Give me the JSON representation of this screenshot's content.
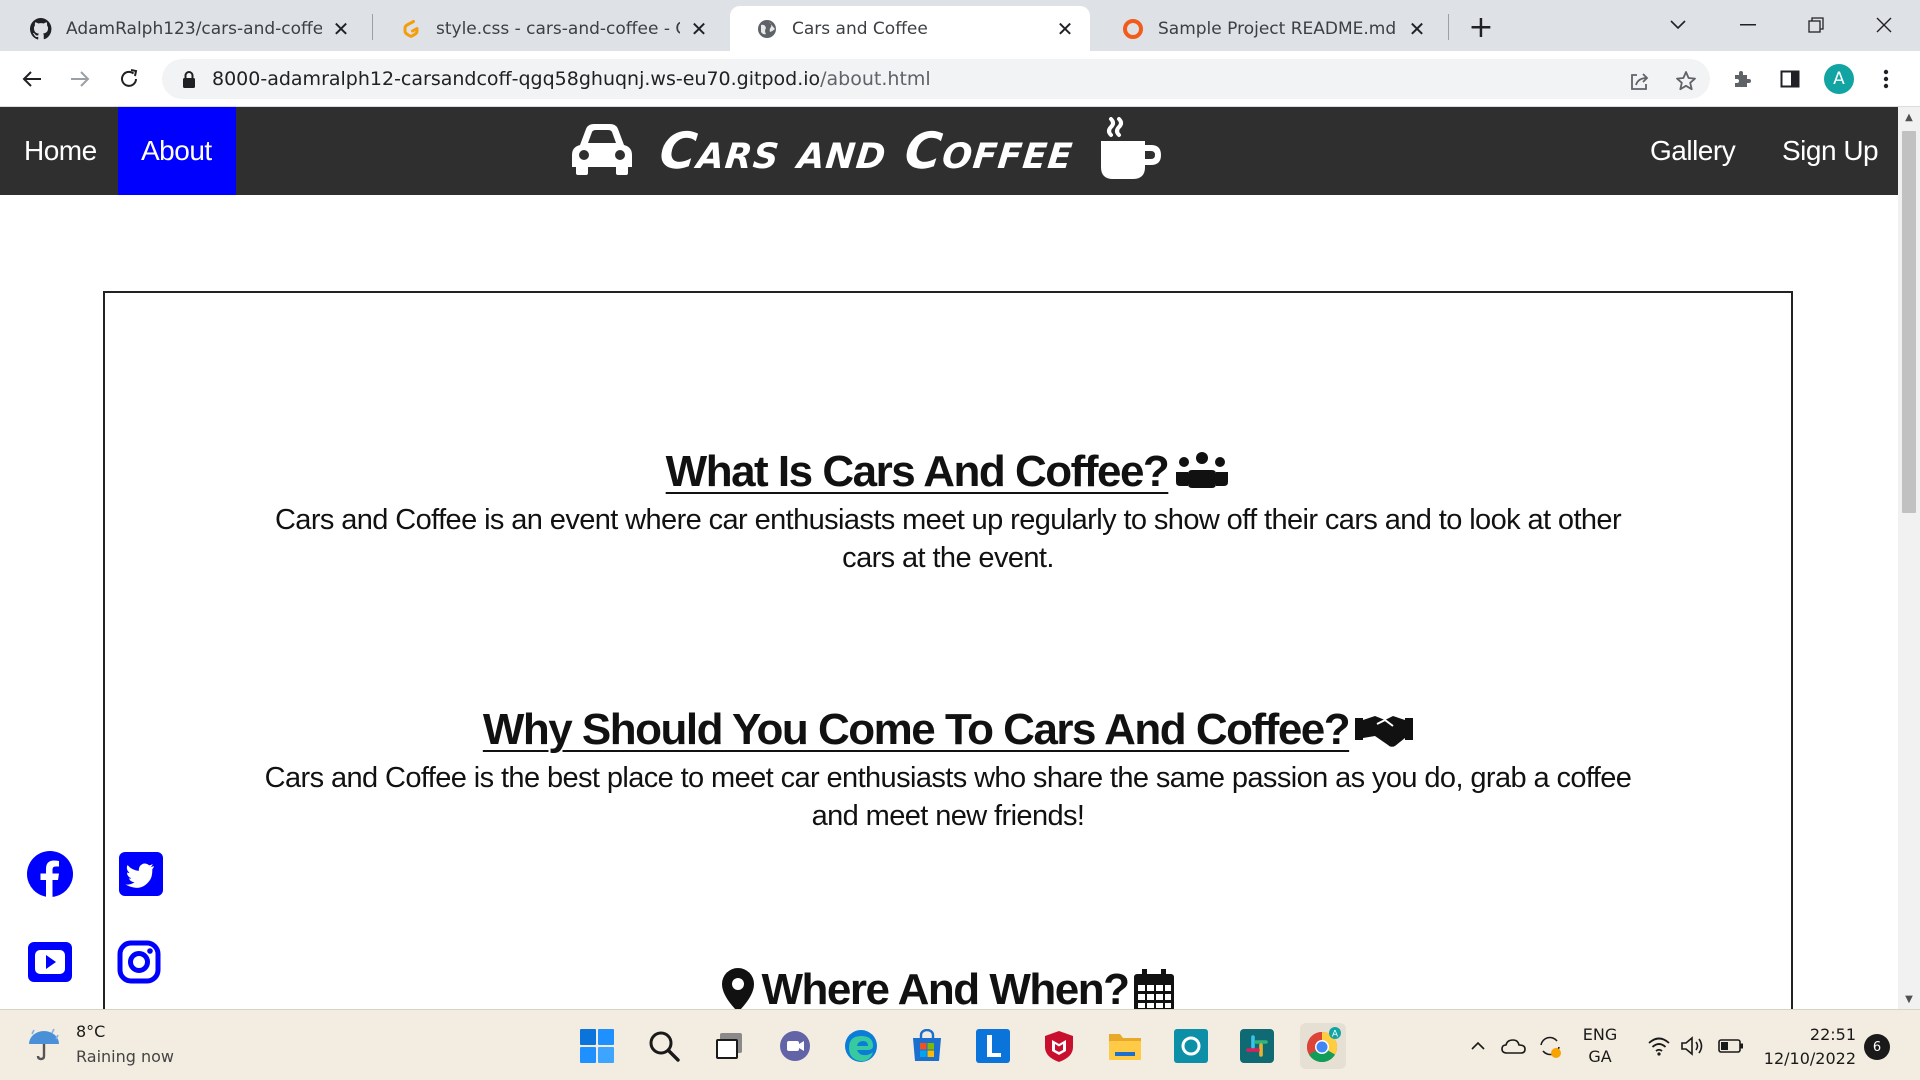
{
  "browser": {
    "tabs": [
      {
        "title": "AdamRalph123/cars-and-coffee:",
        "icon": "github-icon"
      },
      {
        "title": "style.css - cars-and-coffee - Gitpo",
        "icon": "gitpod-icon"
      },
      {
        "title": "Cars and Coffee",
        "icon": "globe-icon"
      },
      {
        "title": "Sample Project README.md | Po",
        "icon": "portfolio-icon"
      }
    ],
    "active_tab": 2,
    "url_host": "8000-adamralph12-carsandcoff-qgq58ghuqnj.ws-eu70.gitpod.io",
    "url_path": "/about.html",
    "profile_initial": "A"
  },
  "site": {
    "nav": {
      "home": "Home",
      "about": "About",
      "gallery": "Gallery",
      "signup": "Sign Up"
    },
    "brand": "Cars and Coffee",
    "sections": [
      {
        "title": "What Is Cars And Coffee?",
        "body": "Cars and Coffee is an event where car enthusiasts meet up regularly to show off their cars and to look at other cars at the event."
      },
      {
        "title": "Why Should You Come To Cars And Coffee?",
        "body": "Cars and Coffee is the best place to meet car enthusiasts who share the same passion as you do, grab a coffee and meet new friends!"
      },
      {
        "title": "Where And When?"
      }
    ],
    "colors": {
      "nav_bg": "#2f2f2f",
      "active": "#0000ff",
      "social": "#0000ff"
    }
  },
  "taskbar": {
    "weather_temp": "8°C",
    "weather_text": "Raining now",
    "lang_top": "ENG",
    "lang_bottom": "GA",
    "time": "22:51",
    "date": "12/10/2022",
    "notifications": "6"
  }
}
